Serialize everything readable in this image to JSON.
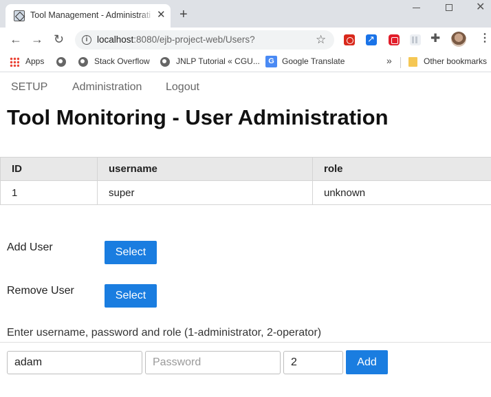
{
  "browser": {
    "tab_title": "Tool Management - Administrati",
    "tab_close": "✕",
    "new_tab": "+",
    "url_host": "localhost",
    "url_path": ":8080/ejb-project-web/Users?",
    "bookmarks": [
      {
        "label": "Apps",
        "icon": "apps-icon"
      },
      {
        "label": "",
        "icon": "globe-icon"
      },
      {
        "label": "Stack Overflow",
        "icon": "globe-icon"
      },
      {
        "label": "JNLP Tutorial « CGU...",
        "icon": "globe-icon"
      },
      {
        "label": "Google Translate",
        "icon": "google-translate-icon"
      }
    ],
    "overflow": "»",
    "other_bookmarks": "Other bookmarks"
  },
  "nav": {
    "setup": "SETUP",
    "administration": "Administration",
    "logout": "Logout"
  },
  "page": {
    "title": "Tool Monitoring - User Administration"
  },
  "table": {
    "headers": [
      "ID",
      "username",
      "role"
    ],
    "rows": [
      [
        "1",
        "super",
        "unknown"
      ]
    ]
  },
  "actions": {
    "add_user_label": "Add User",
    "add_user_button": "Select",
    "remove_user_label": "Remove User",
    "remove_user_button": "Select"
  },
  "form": {
    "hint": "Enter username, password and role (1-administrator, 2-operator)",
    "username_value": "adam",
    "password_placeholder": "Password",
    "role_value": "2",
    "add_button": "Add"
  },
  "colors": {
    "primary_button": "#1a7de0",
    "table_header_bg": "#e8e8e8"
  }
}
